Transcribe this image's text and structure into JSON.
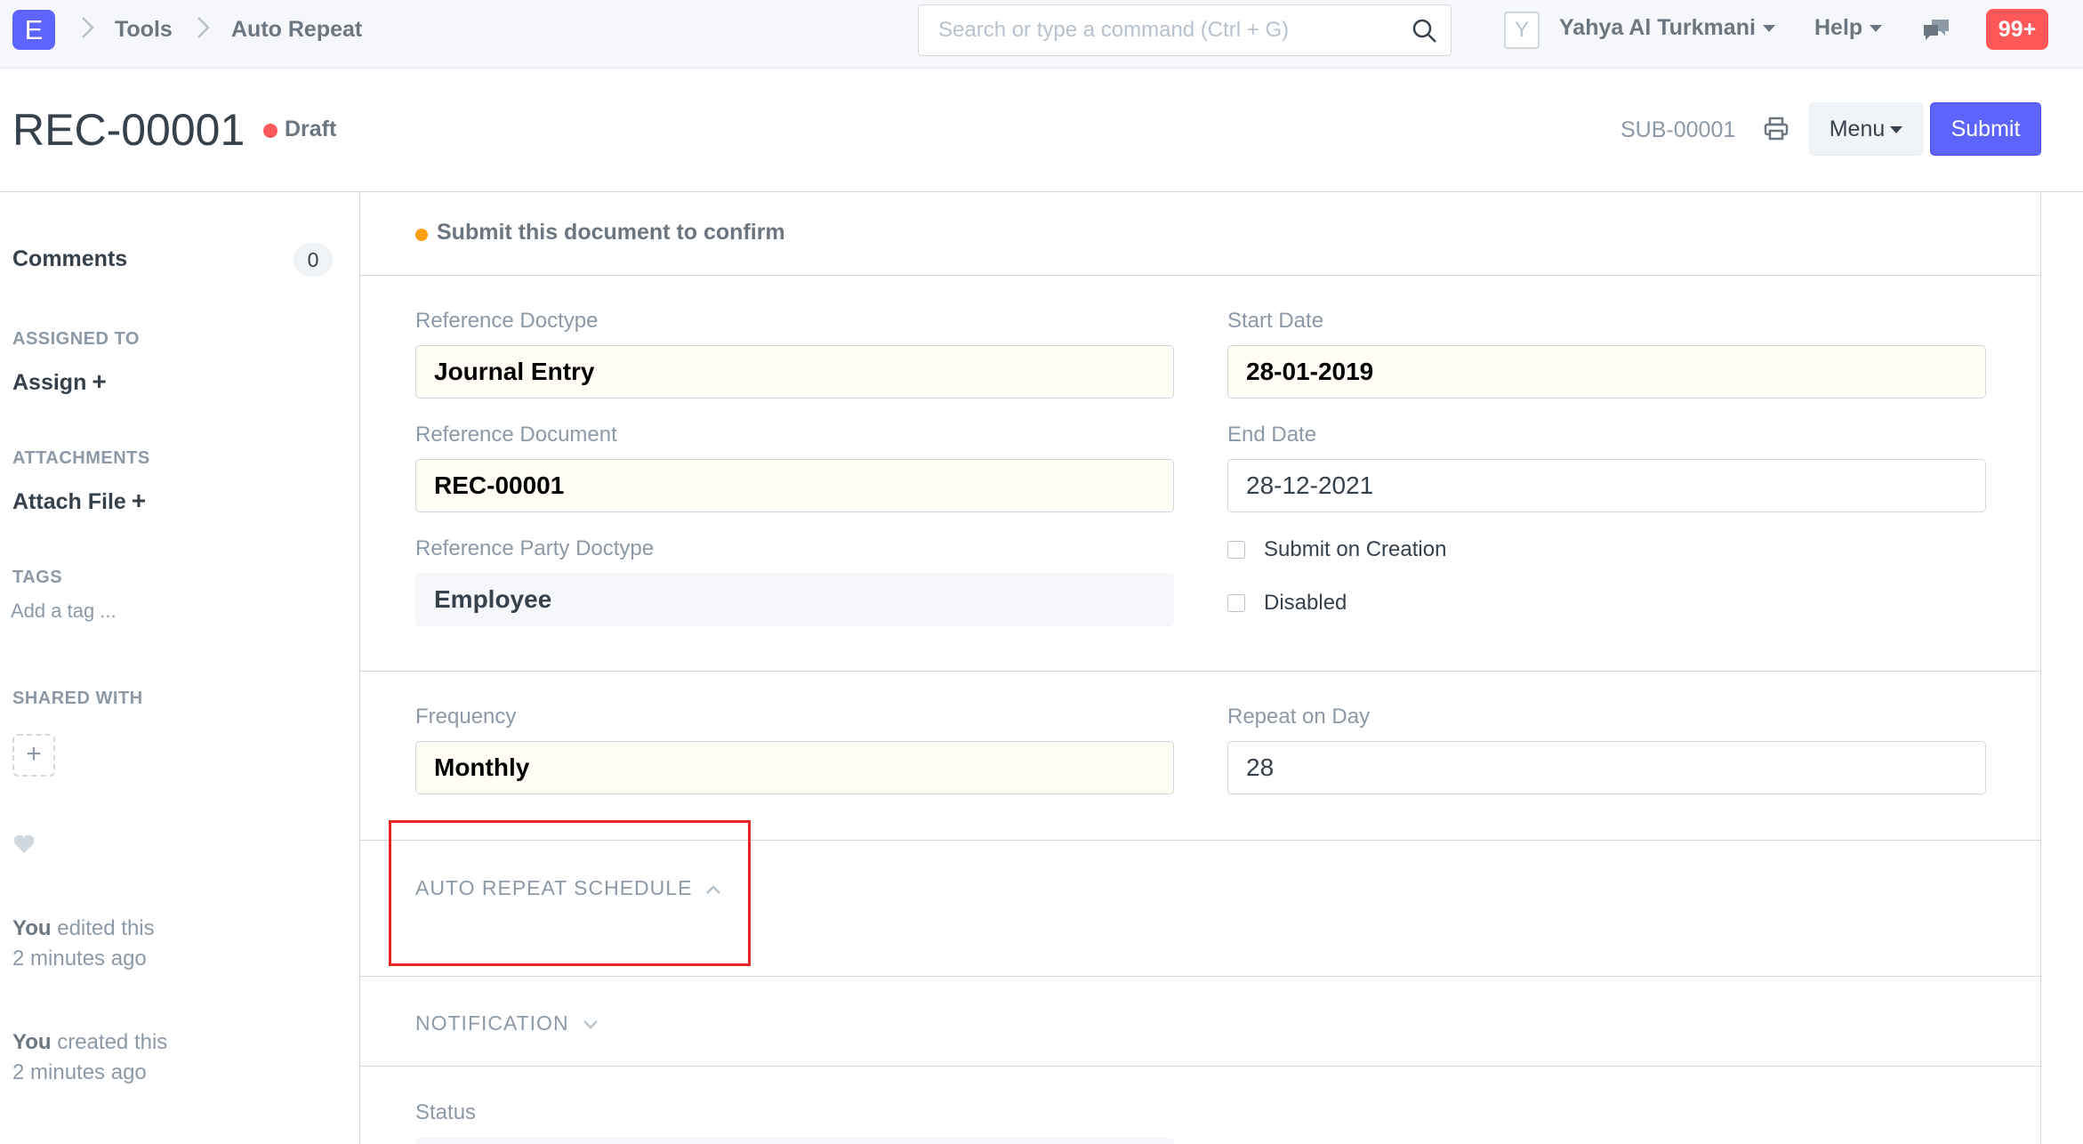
{
  "navbar": {
    "logo_letter": "E",
    "breadcrumbs": [
      "Tools",
      "Auto Repeat"
    ],
    "search_placeholder": "Search or type a command (Ctrl + G)",
    "avatar_letter": "Y",
    "user_name": "Yahya Al Turkmani",
    "help_label": "Help",
    "notification_count": "99+"
  },
  "page": {
    "title": "REC-00001",
    "status": "Draft",
    "status_color": "#ff5858",
    "subscription_id": "SUB-00001",
    "menu_label": "Menu",
    "submit_label": "Submit",
    "accent_color": "#5e64ff"
  },
  "sidebar": {
    "comments_label": "Comments",
    "comments_count": "0",
    "assigned_to_label": "ASSIGNED TO",
    "assign_label": "Assign",
    "attachments_label": "ATTACHMENTS",
    "attach_label": "Attach File",
    "tags_label": "TAGS",
    "tag_placeholder": "Add a tag ...",
    "shared_with_label": "SHARED WITH",
    "activity": [
      {
        "who": "You",
        "action": "edited this",
        "when": "2 minutes ago"
      },
      {
        "who": "You",
        "action": "created this",
        "when": "2 minutes ago"
      }
    ]
  },
  "form": {
    "alert": "Submit this document to confirm",
    "fields": {
      "reference_doctype": {
        "label": "Reference Doctype",
        "value": "Journal Entry"
      },
      "reference_document": {
        "label": "Reference Document",
        "value": "REC-00001"
      },
      "reference_party_doctype": {
        "label": "Reference Party Doctype",
        "value": "Employee"
      },
      "start_date": {
        "label": "Start Date",
        "value": "28-01-2019"
      },
      "end_date": {
        "label": "End Date",
        "value": "28-12-2021"
      },
      "submit_on_creation": {
        "label": "Submit on Creation",
        "checked": false
      },
      "disabled": {
        "label": "Disabled",
        "checked": false
      },
      "frequency": {
        "label": "Frequency",
        "value": "Monthly"
      },
      "repeat_on_day": {
        "label": "Repeat on Day",
        "value": "28"
      },
      "status": {
        "label": "Status"
      }
    },
    "sections": {
      "schedule": "AUTO REPEAT SCHEDULE",
      "notification": "NOTIFICATION"
    }
  }
}
